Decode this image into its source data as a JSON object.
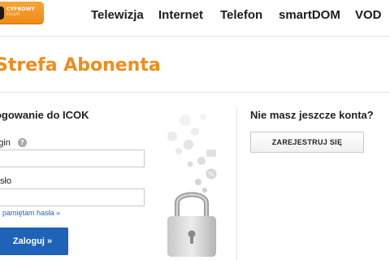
{
  "header": {
    "logo": {
      "line1": "CYFROWY",
      "line2": "POLSAT"
    },
    "nav": [
      {
        "label": "Telewizja"
      },
      {
        "label": "Internet"
      },
      {
        "label": "Telefon"
      },
      {
        "label": "smartDOM"
      },
      {
        "label": "VOD"
      }
    ]
  },
  "page_title": "Strefa Abonenta",
  "login": {
    "section_title": "Logowanie do ICOK",
    "login_label": "Login",
    "login_help_icon": "?",
    "login_value": "",
    "password_label": "Hasło",
    "password_value": "",
    "forgot_link": "Nie pamiętam hasła »",
    "submit_label": "Zaloguj »"
  },
  "register": {
    "title": "Nie masz jeszcze konta?",
    "button_label": "ZAREJESTRUJ SIĘ"
  },
  "illustration": {
    "icon": "padlock-icon",
    "percent_bubble": "%"
  },
  "colors": {
    "brand_orange": "#f08c1a",
    "primary_blue": "#1f63b8",
    "link_blue": "#2b62b4"
  }
}
